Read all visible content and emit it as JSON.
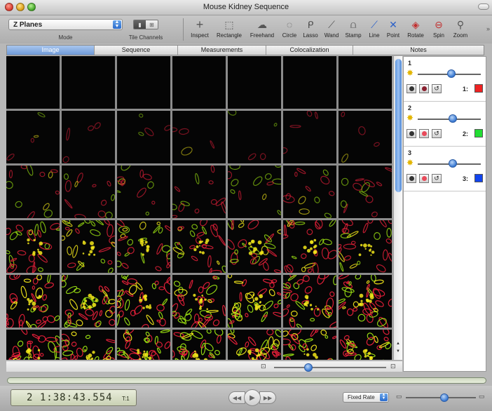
{
  "window": {
    "title": "Mouse Kidney Sequence"
  },
  "toolbar": {
    "mode": {
      "value": "Z Planes",
      "caption": "Mode"
    },
    "tile_channels": {
      "caption": "Tile Channels"
    },
    "tools": [
      {
        "id": "inspect",
        "label": "Inspect",
        "icon": "crosshair-icon"
      },
      {
        "id": "rectangle",
        "label": "Rectangle",
        "icon": "rectangle-select-icon"
      },
      {
        "id": "freehand",
        "label": "Freehand",
        "icon": "freehand-icon"
      },
      {
        "id": "circle",
        "label": "Circle",
        "icon": "circle-select-icon"
      },
      {
        "id": "lasso",
        "label": "Lasso",
        "icon": "lasso-icon"
      },
      {
        "id": "wand",
        "label": "Wand",
        "icon": "magic-wand-icon"
      },
      {
        "id": "stamp",
        "label": "Stamp",
        "icon": "stamp-icon"
      },
      {
        "id": "line",
        "label": "Line",
        "icon": "line-tool-icon"
      },
      {
        "id": "point",
        "label": "Point",
        "icon": "point-tool-icon"
      },
      {
        "id": "rotate",
        "label": "Rotate",
        "icon": "rotate-icon"
      },
      {
        "id": "spin",
        "label": "Spin",
        "icon": "spin-icon"
      },
      {
        "id": "zoom",
        "label": "Zoom",
        "icon": "magnifier-icon"
      }
    ]
  },
  "tabs": [
    {
      "label": "Image",
      "active": true
    },
    {
      "label": "Sequence",
      "active": false
    },
    {
      "label": "Measurements",
      "active": false
    },
    {
      "label": "Colocalization",
      "active": false
    },
    {
      "label": "Notes",
      "active": false
    }
  ],
  "image_grid": {
    "columns": 7,
    "rows": 6,
    "row_signal_levels": [
      0.0,
      0.12,
      0.35,
      0.7,
      0.95,
      1.0
    ]
  },
  "channels": [
    {
      "number": "1",
      "label": "1:",
      "color": "#ee2222",
      "brightness": 0.53
    },
    {
      "number": "2",
      "label": "2:",
      "color": "#22dd33",
      "brightness": 0.55
    },
    {
      "number": "3",
      "label": "3:",
      "color": "#1144ee",
      "brightness": 0.55
    }
  ],
  "playback": {
    "timecode": "2 1:38:43.554",
    "frame": "T:1",
    "rate": "Fixed Rate",
    "speed": 0.55
  },
  "colors": {
    "active_tab": "#6f9ad8",
    "accent": "#3677d2",
    "signal_red": "#e8203a",
    "signal_green": "#9adf12",
    "signal_yellow": "#f2e61a"
  }
}
